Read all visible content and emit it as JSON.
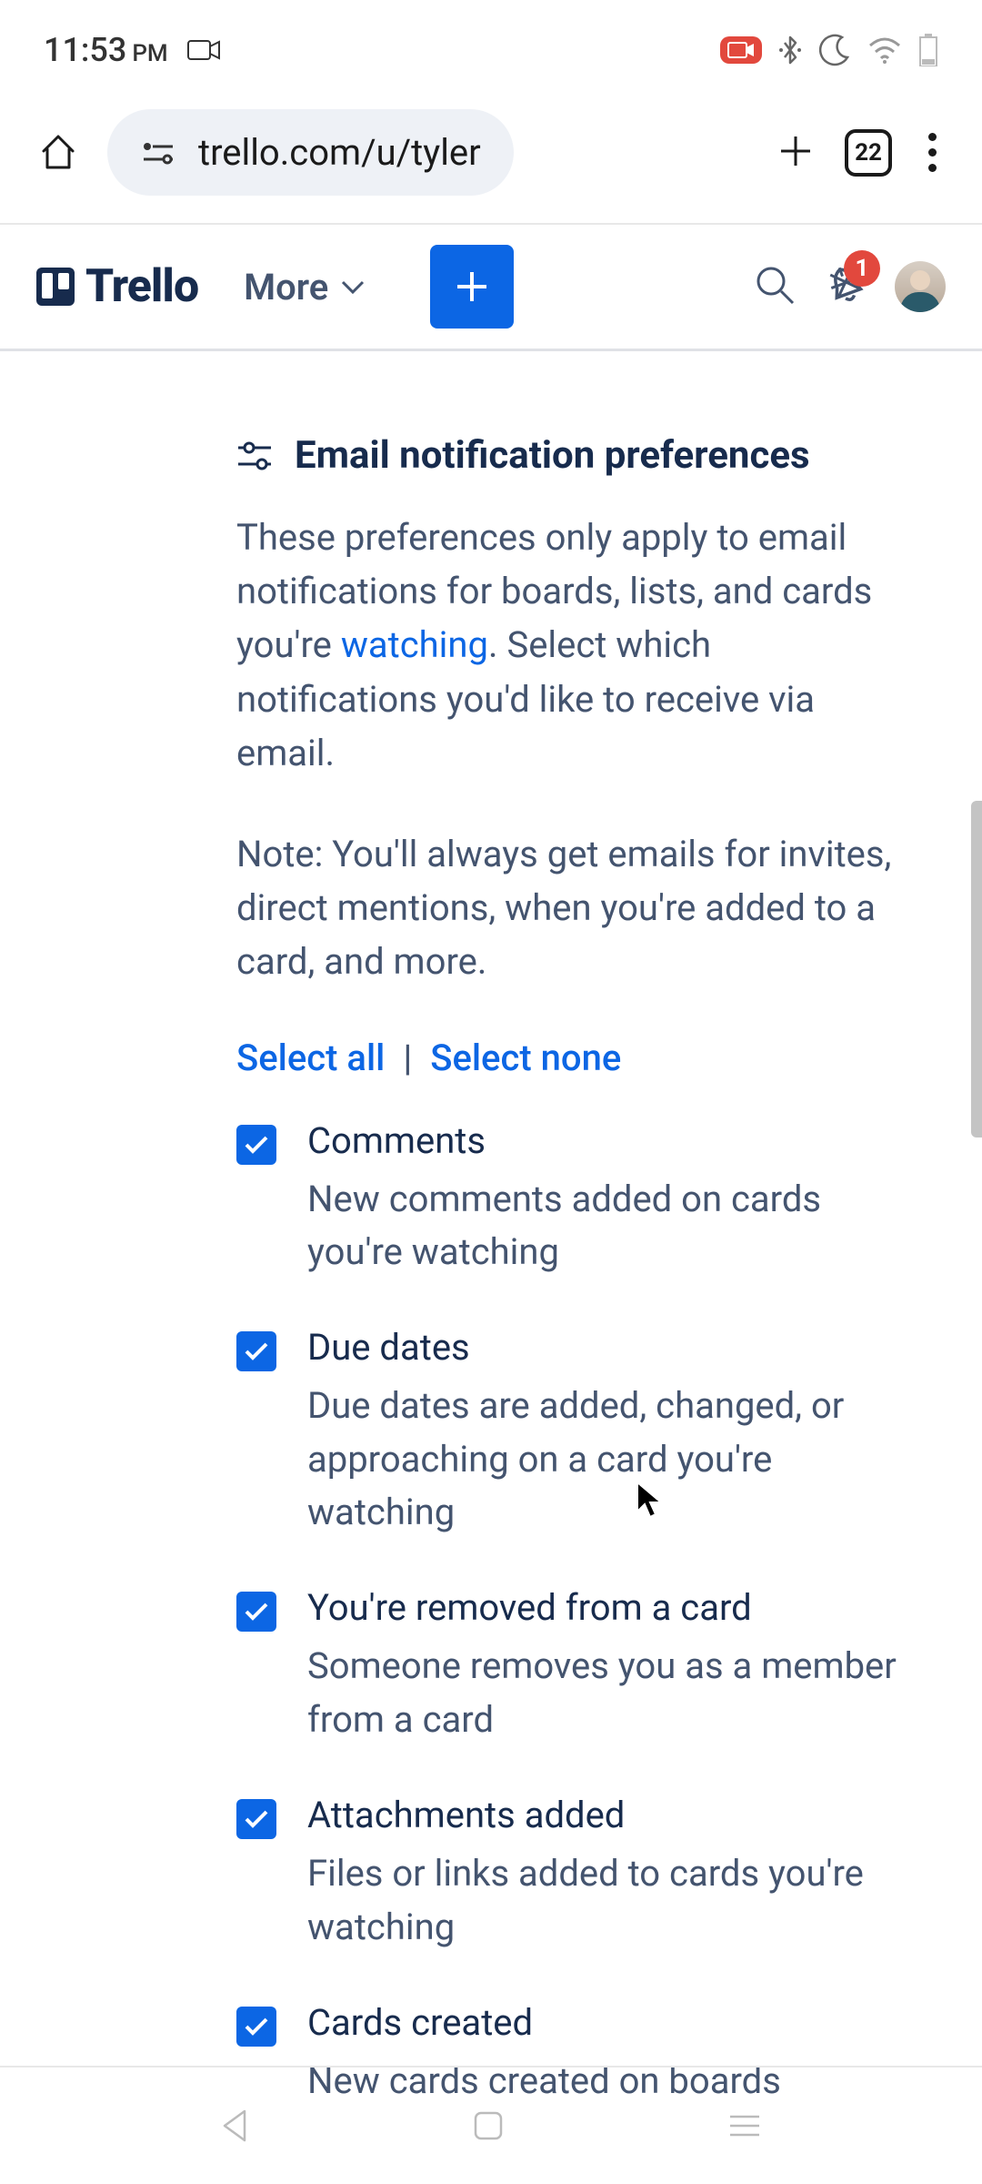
{
  "status": {
    "time": "11:53",
    "period": "PM"
  },
  "browser": {
    "url": "trello.com/u/tyler",
    "tab_count": "22"
  },
  "header": {
    "brand": "Trello",
    "more_label": "More",
    "notif_count": "1"
  },
  "section": {
    "title": "Email notification preferences",
    "desc_part1": "These preferences only apply to email notifications for boards, lists, and cards you're ",
    "desc_link": "watching",
    "desc_part2": ". Select which notifications you'd like to receive via email.",
    "note": "Note: You'll always get emails for invites, direct mentions, when you're added to a card, and more.",
    "select_all": "Select all",
    "select_none": "Select none"
  },
  "prefs": [
    {
      "title": "Comments",
      "desc": "New comments added on cards you're watching",
      "checked": true
    },
    {
      "title": "Due dates",
      "desc": "Due dates are added, changed, or approaching on a card you're watching",
      "checked": true
    },
    {
      "title": "You're removed from a card",
      "desc": "Someone removes you as a member from a card",
      "checked": true
    },
    {
      "title": "Attachments added",
      "desc": "Files or links added to cards you're watching",
      "checked": true
    },
    {
      "title": "Cards created",
      "desc": "New cards created on boards",
      "checked": true
    }
  ]
}
